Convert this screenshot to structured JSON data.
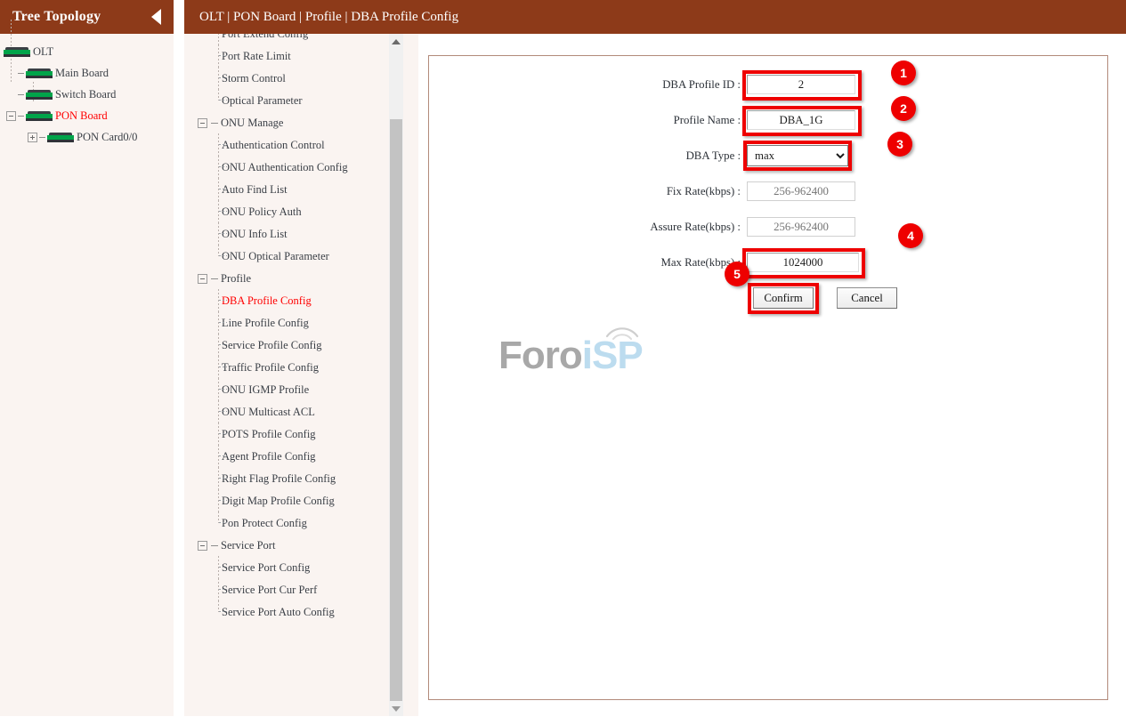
{
  "sidebar": {
    "title": "Tree Topology",
    "collapse_icon": "triangle-left-icon",
    "tree": [
      {
        "label": "OLT",
        "icon": "board-icon",
        "level": 0,
        "toggle": "none",
        "active": false
      },
      {
        "label": "Main Board",
        "icon": "board-icon",
        "level": 1,
        "toggle": "none",
        "active": false
      },
      {
        "label": "Switch Board",
        "icon": "board-icon",
        "level": 1,
        "toggle": "none",
        "active": false
      },
      {
        "label": "PON Board",
        "icon": "board-icon",
        "level": 1,
        "toggle": "minus",
        "active": true
      },
      {
        "label": "PON Card0/0",
        "icon": "board-icon",
        "level": 2,
        "toggle": "plus",
        "active": false
      }
    ]
  },
  "header": {
    "breadcrumb": "OLT | PON Board | Profile | DBA Profile Config"
  },
  "menu": {
    "items": [
      {
        "label": "Port Extend Config",
        "type": "leaf",
        "active": false
      },
      {
        "label": "Port Rate Limit",
        "type": "leaf",
        "active": false
      },
      {
        "label": "Storm Control",
        "type": "leaf",
        "active": false
      },
      {
        "label": "Optical Parameter",
        "type": "leaf",
        "active": false,
        "last": true
      },
      {
        "label": "ONU Manage",
        "type": "group",
        "active": false
      },
      {
        "label": "Authentication Control",
        "type": "leaf",
        "active": false
      },
      {
        "label": "ONU Authentication Config",
        "type": "leaf",
        "active": false
      },
      {
        "label": "Auto Find List",
        "type": "leaf",
        "active": false
      },
      {
        "label": "ONU Policy Auth",
        "type": "leaf",
        "active": false
      },
      {
        "label": "ONU Info List",
        "type": "leaf",
        "active": false
      },
      {
        "label": "ONU Optical Parameter",
        "type": "leaf",
        "active": false,
        "last": true
      },
      {
        "label": "Profile",
        "type": "group",
        "active": false
      },
      {
        "label": "DBA Profile Config",
        "type": "leaf",
        "active": true
      },
      {
        "label": "Line Profile Config",
        "type": "leaf",
        "active": false
      },
      {
        "label": "Service Profile Config",
        "type": "leaf",
        "active": false
      },
      {
        "label": "Traffic Profile Config",
        "type": "leaf",
        "active": false
      },
      {
        "label": "ONU IGMP Profile",
        "type": "leaf",
        "active": false
      },
      {
        "label": "ONU Multicast ACL",
        "type": "leaf",
        "active": false
      },
      {
        "label": "POTS Profile Config",
        "type": "leaf",
        "active": false
      },
      {
        "label": "Agent Profile Config",
        "type": "leaf",
        "active": false
      },
      {
        "label": "Right Flag Profile Config",
        "type": "leaf",
        "active": false
      },
      {
        "label": "Digit Map Profile Config",
        "type": "leaf",
        "active": false
      },
      {
        "label": "Pon Protect Config",
        "type": "leaf",
        "active": false,
        "last": true
      },
      {
        "label": "Service Port",
        "type": "group",
        "active": false
      },
      {
        "label": "Service Port Config",
        "type": "leaf",
        "active": false
      },
      {
        "label": "Service Port Cur Perf",
        "type": "leaf",
        "active": false
      },
      {
        "label": "Service Port Auto Config",
        "type": "leaf",
        "active": false,
        "last": true
      }
    ],
    "scroll_up_icon": "arrow-up-icon",
    "scroll_down_icon": "arrow-down-icon"
  },
  "form": {
    "fields": [
      {
        "label": "DBA Profile ID :",
        "value": "2",
        "placeholder": "",
        "disabled": false,
        "control": "text"
      },
      {
        "label": "Profile Name :",
        "value": "DBA_1G",
        "placeholder": "",
        "disabled": false,
        "control": "text"
      },
      {
        "label": "DBA Type :",
        "value": "max",
        "options": [
          "max"
        ],
        "disabled": false,
        "control": "select"
      },
      {
        "label": "Fix Rate(kbps) :",
        "value": "",
        "placeholder": "256-962400",
        "disabled": true,
        "control": "text"
      },
      {
        "label": "Assure Rate(kbps) :",
        "value": "",
        "placeholder": "256-962400",
        "disabled": true,
        "control": "text"
      },
      {
        "label": "Max Rate(kbps) :",
        "value": "1024000",
        "placeholder": "",
        "disabled": false,
        "control": "text"
      }
    ],
    "confirm_label": "Confirm",
    "cancel_label": "Cancel"
  },
  "annotations": {
    "badges": [
      "1",
      "2",
      "3",
      "4",
      "5"
    ],
    "color": "#ee0000"
  },
  "watermark": {
    "text_primary": "Foro",
    "text_secondary": "iSP",
    "color_primary": "#a8a8a8",
    "color_secondary": "#bcdcef"
  },
  "theme": {
    "header_bg": "#8d3a19",
    "panel_bg": "#faf4f1",
    "border": "#b28a7a",
    "accent_red": "#ff0000"
  }
}
